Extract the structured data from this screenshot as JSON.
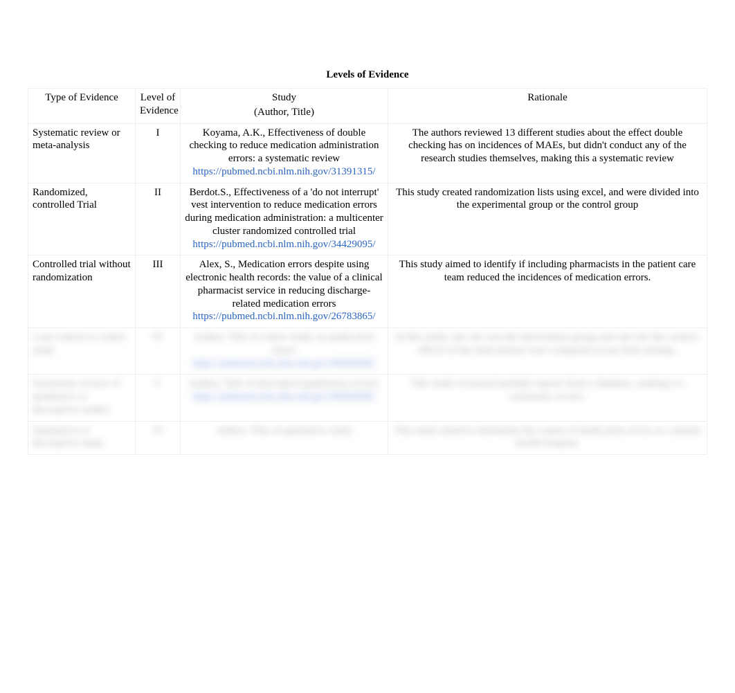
{
  "title": "Levels of Evidence",
  "headers": {
    "type": "Type of Evidence",
    "level": "Level of Evidence",
    "study": "Study",
    "study_sub": "(Author, Title)",
    "rationale": "Rationale"
  },
  "rows": [
    {
      "type": "Systematic review or meta-analysis",
      "level": "I",
      "study": "Koyama, A.K., Effectiveness of double checking to reduce medication administration errors: a systematic review",
      "link": "https://pubmed.ncbi.nlm.nih.gov/31391315/",
      "rationale": "The authors reviewed 13 different studies about the effect double checking has on incidences of MAEs, but didn't conduct any of the research studies themselves, making this a systematic review"
    },
    {
      "type": "Randomized, controlled Trial",
      "level": "II",
      "study": "Berdot.S., Effectiveness of a 'do not interrupt' vest intervention to reduce medication errors during medication administration: a multicenter cluster randomized controlled trial",
      "link": "https://pubmed.ncbi.nlm.nih.gov/34429095/",
      "rationale": "This study created randomization lists using excel, and were divided into the experimental group or the control group"
    },
    {
      "type": "Controlled trial without randomization",
      "level": "III",
      "study": "Alex, S., Medication errors despite using electronic health records: the value of a clinical pharmacist service in reducing discharge-related medication errors",
      "link": "https://pubmed.ncbi.nlm.nih.gov/26783865/",
      "rationale": "This study aimed to identify if including pharmacists in the patient care team reduced the incidences of medication errors."
    },
    {
      "type": "Case-control or cohort study",
      "level": "IV",
      "study": "Author, Title of cohort study on medication errors",
      "link": "https://pubmed.ncbi.nlm.nih.gov/00000000/",
      "rationale": "In this study, one site was the intervention group and one site the control; effects of the intervention were compared across both settings."
    },
    {
      "type": "Systematic review of qualitative or descriptive studies",
      "level": "V",
      "study": "Author, Title of descriptive/qualitative review",
      "link": "https://pubmed.ncbi.nlm.nih.gov/00000000/",
      "rationale": "This study reviewed multiple reports from a database, making it a systematic review."
    },
    {
      "type": "Qualitative or descriptive study",
      "level": "VI",
      "study": "Author, Title of qualitative study",
      "link": "",
      "rationale": "This study aimed to determine the causes of medication errors in a mental health hospital."
    }
  ]
}
